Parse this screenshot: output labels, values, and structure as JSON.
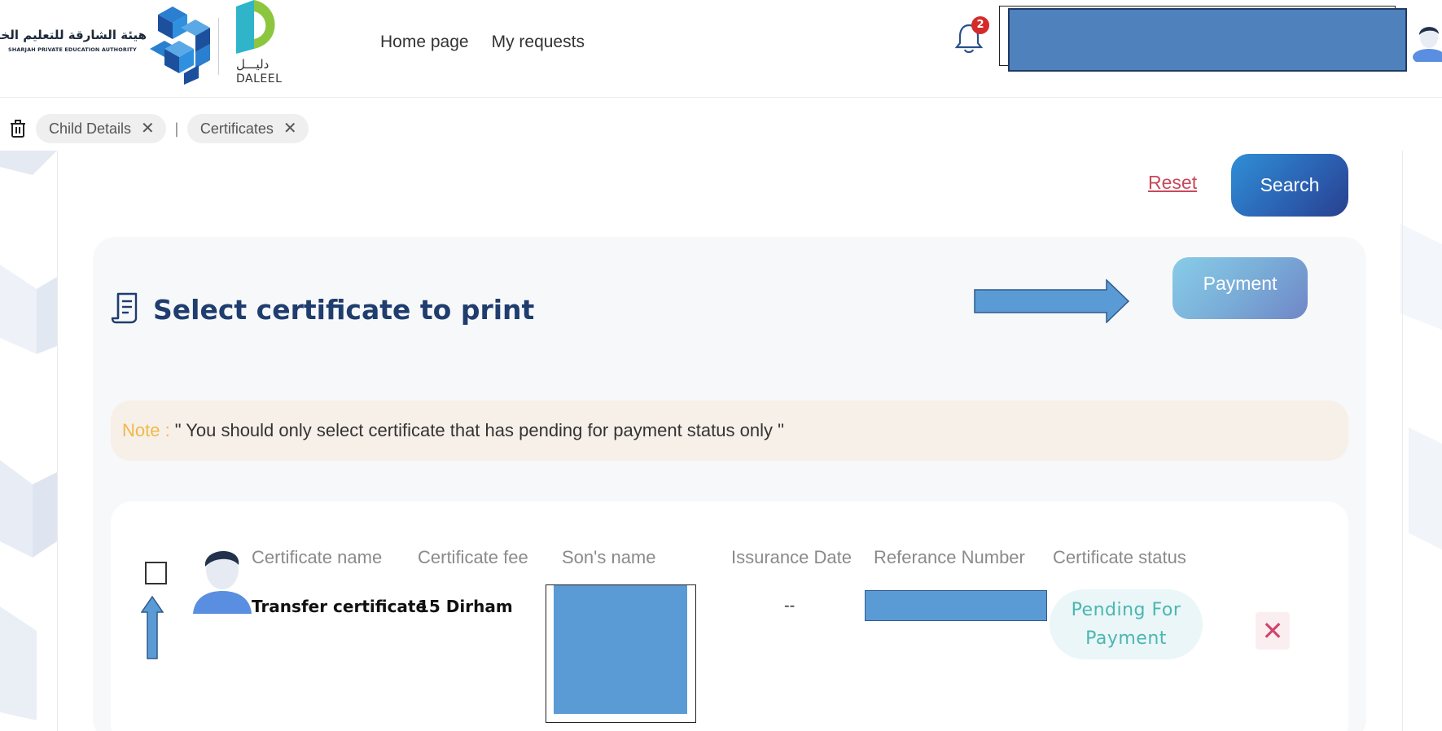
{
  "header": {
    "spea_name_ar": "هيئة الشارقة للتعليم الخاص",
    "spea_name_en": "SHARJAH PRIVATE EDUCATION AUTHORITY",
    "daleel_ar": "دليـــل",
    "daleel_en": "DALEEL",
    "nav": [
      {
        "label": "Home page"
      },
      {
        "label": "My requests"
      }
    ],
    "notification_count": "2"
  },
  "tabs": [
    {
      "label": "Child Details"
    },
    {
      "label": "Certificates"
    }
  ],
  "filters": {
    "reset_label": "Reset",
    "search_label": "Search"
  },
  "main": {
    "title": "Select certificate to print",
    "payment_label": "Payment",
    "note_label": "Note :",
    "note_text": "\" You should only select certificate that has pending for payment status only \""
  },
  "table": {
    "headers": [
      "Certificate name",
      "Certificate fee",
      "Son's name",
      "Issurance Date",
      "Referance Number",
      "Certificate status"
    ],
    "rows": [
      {
        "certificate_name": "Transfer certificate",
        "certificate_fee": "15 Dirham",
        "issuance_date": "--",
        "status": "Pending For Payment",
        "remove_glyph": "✕"
      }
    ]
  },
  "colors": {
    "brand_navy": "#1f3d6e",
    "search_gradient": "#2f8fd6",
    "payment_gradient": "#88cce8",
    "reset_red": "#c9485b",
    "note_yellow": "#f0b94a",
    "status_teal": "#4bb6b1",
    "redaction_blue": "#5b9bd5"
  },
  "icons": [
    "spea-logo-icon",
    "daleel-logo-icon",
    "bell-icon",
    "avatar-icon",
    "trash-icon",
    "close-icon",
    "certificate-doc-icon",
    "arrow-right-icon",
    "arrow-up-icon"
  ]
}
